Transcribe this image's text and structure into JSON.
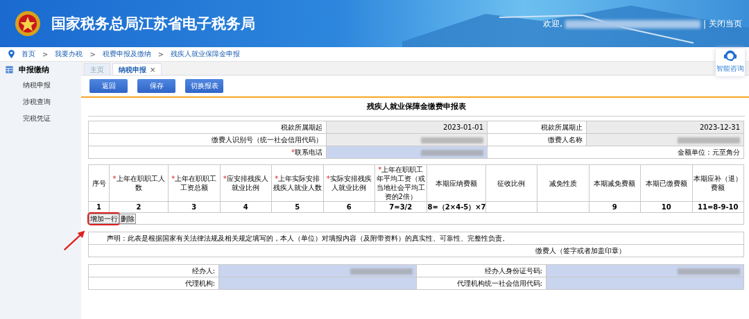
{
  "header": {
    "title": "国家税务总局江苏省电子税务局",
    "welcome": "欢迎,",
    "separator": "|",
    "close_link": "关闭当页"
  },
  "breadcrumb": {
    "separator": ">",
    "items": [
      "首页",
      "我要办税",
      "税费申报及缴纳",
      "残疾人就业保障金申报"
    ]
  },
  "help_widget": {
    "label": "智能咨询"
  },
  "sidebar": {
    "group": "申报缴纳",
    "items": [
      {
        "label": "纳税申报"
      },
      {
        "label": "涉税查询"
      },
      {
        "label": "完税凭证"
      }
    ]
  },
  "tabs": [
    {
      "label": "主页",
      "selected": false
    },
    {
      "label": "纳税申报",
      "selected": true,
      "close": "×"
    }
  ],
  "toolbar": [
    "返回",
    "保存",
    "切换报表"
  ],
  "form_title": "残疾人就业保障金缴费申报表",
  "info_rows": [
    [
      {
        "kind": "label",
        "text": "税款所属期起"
      },
      {
        "kind": "value",
        "editable": false,
        "text": "2023-01-01"
      },
      {
        "kind": "label",
        "text": "税款所属期止"
      },
      {
        "kind": "value",
        "editable": false,
        "text": "2023-12-31"
      }
    ],
    [
      {
        "kind": "label",
        "text": "缴费人识别号（统一社会信用代码）"
      },
      {
        "kind": "redacted",
        "editable": false
      },
      {
        "kind": "label",
        "text": "缴费人名称"
      },
      {
        "kind": "redacted",
        "editable": false
      }
    ],
    [
      {
        "kind": "label",
        "req": "*",
        "text": "联系电话"
      },
      {
        "kind": "redacted",
        "editable": true
      },
      {
        "kind": "note",
        "text": "金额单位：元至角分"
      }
    ]
  ],
  "grid": {
    "columns": [
      {
        "label": "序号",
        "formula": "1"
      },
      {
        "req": "*",
        "label": "上年在职职工人数",
        "formula": "2"
      },
      {
        "req": "*",
        "label": "上年在职职工工资总额",
        "formula": "3"
      },
      {
        "req": "*",
        "label": "应安排残疾人就业比例",
        "formula": "4"
      },
      {
        "req": "*",
        "label": "上年实际安排残疾人就业人数",
        "formula": "5"
      },
      {
        "req": "*",
        "label": "实际安排残疾人就业比例",
        "formula": "6"
      },
      {
        "req": "*",
        "label": "上年在职职工年平均工资（或当地社会平均工资的2倍）",
        "formula": "7=3/2"
      },
      {
        "label": "本期应纳费额",
        "formula": "8=（2×4-5）×7"
      },
      {
        "label": "征收比例"
      },
      {
        "label": "减免性质"
      },
      {
        "label": "本期减免费额",
        "formula": "9"
      },
      {
        "label": "本期已缴费额",
        "formula": "10"
      },
      {
        "label": "本期应补（退）费额",
        "formula": "11=8-9-10"
      }
    ]
  },
  "row_actions": [
    {
      "label": "增加一行",
      "highlighted": true
    },
    {
      "label": "删除",
      "highlighted": false
    }
  ],
  "declaration": {
    "text": "声明：此表是根据国家有关法律法规及相关规定填写的，本人（单位）对填报内容（及附带资料）的真实性、可靠性、完整性负责。",
    "signature": "缴费人（签字或者加盖印章）"
  },
  "agent_rows": [
    [
      {
        "kind": "label",
        "text": "经办人:"
      },
      {
        "kind": "redacted",
        "editable": true
      },
      {
        "kind": "label",
        "text": "经办人身份证号码:"
      },
      {
        "kind": "redacted",
        "editable": true
      }
    ],
    [
      {
        "kind": "label",
        "text": "代理机构:"
      },
      {
        "kind": "empty",
        "editable": true
      },
      {
        "kind": "label",
        "text": "代理机构统一社会信用代码:"
      },
      {
        "kind": "empty",
        "editable": true
      }
    ]
  ]
}
